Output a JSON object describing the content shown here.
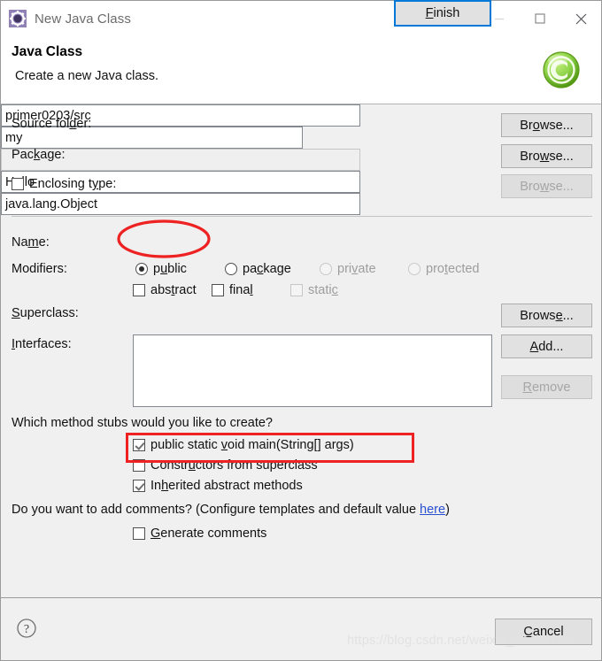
{
  "window": {
    "title": "New Java Class",
    "icon": "java-class-wizard-icon",
    "minimize_label": "—",
    "maximize_label": "□",
    "close_label": "✕"
  },
  "header": {
    "title": "Java Class",
    "subtitle": "Create a new Java class.",
    "badge_letter": "C"
  },
  "form": {
    "source_folder": {
      "label_pre": "Source fol",
      "label_mnemonic": "d",
      "label_post": "er:",
      "value": "primer0203/src",
      "button": "Browse...",
      "button_mnemonic_before": "Br",
      "button_mnemonic": "o",
      "button_mnemonic_after": "wse..."
    },
    "package": {
      "label_pre": "Pac",
      "label_mnemonic": "k",
      "label_post": "age:",
      "value": "my",
      "button": "Browse...",
      "button_mnemonic_before": "Bro",
      "button_mnemonic": "w",
      "button_mnemonic_after": "se..."
    },
    "enclosing_type": {
      "label_pre": "Enclosing t",
      "label_mnemonic": "y",
      "label_post": "pe:",
      "checked": false,
      "value": "",
      "enabled": false,
      "button": "Browse...",
      "button_mnemonic_before": "Bro",
      "button_mnemonic": "w",
      "button_mnemonic_after": "se...",
      "button_enabled": false
    },
    "name": {
      "label_pre": "Na",
      "label_mnemonic": "m",
      "label_post": "e:",
      "value": "Hello"
    },
    "modifiers": {
      "label": "Modifiers:",
      "radios": [
        {
          "pre": "p",
          "mnemonic": "u",
          "post": "blic",
          "selected": true,
          "enabled": true
        },
        {
          "pre": "pa",
          "mnemonic": "c",
          "post": "kage",
          "selected": false,
          "enabled": true
        },
        {
          "pre": "pri",
          "mnemonic": "v",
          "post": "ate",
          "selected": false,
          "enabled": false
        },
        {
          "pre": "pro",
          "mnemonic": "t",
          "post": "ected",
          "selected": false,
          "enabled": false
        }
      ],
      "checks": [
        {
          "pre": "abs",
          "mnemonic": "t",
          "post": "ract",
          "checked": false,
          "enabled": true
        },
        {
          "pre": "fina",
          "mnemonic": "l",
          "post": "",
          "checked": false,
          "enabled": true
        },
        {
          "pre": "stati",
          "mnemonic": "c",
          "post": "",
          "checked": false,
          "enabled": false
        }
      ]
    },
    "superclass": {
      "label_pre": "",
      "label_mnemonic": "S",
      "label_post": "uperclass:",
      "value": "java.lang.Object",
      "button": "Browse...",
      "button_mnemonic_before": "Brows",
      "button_mnemonic": "e",
      "button_mnemonic_after": "..."
    },
    "interfaces": {
      "label_pre": "",
      "label_mnemonic": "I",
      "label_post": "nterfaces:",
      "value": "",
      "add_button_mnemonic": "A",
      "add_button_after": "dd...",
      "remove_button_mnemonic": "R",
      "remove_button_after": "emove",
      "remove_enabled": false
    }
  },
  "stubs": {
    "question": "Which method stubs would you like to create?",
    "items": [
      {
        "pre": "public static ",
        "mnemonic": "v",
        "post": "oid main(String[] args)",
        "checked": true
      },
      {
        "pre": "Constr",
        "mnemonic": "u",
        "post": "ctors from superclass",
        "checked": false
      },
      {
        "pre": "In",
        "mnemonic": "h",
        "post": "erited abstract methods",
        "checked": true
      }
    ]
  },
  "comments": {
    "question_pre": "Do you want to add comments? (Configure templates and default value ",
    "link": "here",
    "question_post": ")",
    "generate": {
      "pre": "",
      "mnemonic": "G",
      "post": "enerate comments",
      "checked": false
    }
  },
  "footer": {
    "help_icon": "question-mark-icon",
    "finish": {
      "mnemonic": "F",
      "after": "inish"
    },
    "cancel": {
      "mnemonic": "C",
      "after": "ancel"
    }
  },
  "annotations": {
    "ellipse_target": "name-field",
    "rect_target": "main-method-stub",
    "color": "#ee2222"
  },
  "watermark": "https://blog.csdn.net/weixin_44421798"
}
